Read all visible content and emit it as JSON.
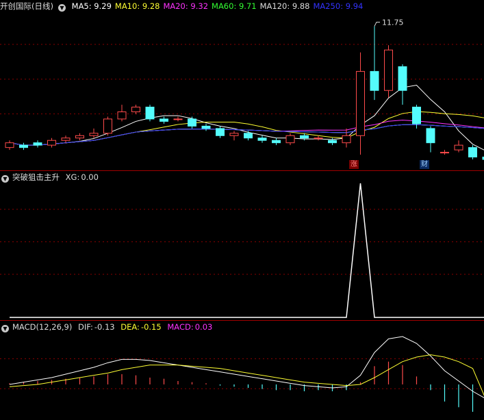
{
  "colors": {
    "up": "#ff4b4b",
    "down": "#54fcfc",
    "ma5": "#ffffff",
    "ma10": "#ffff33",
    "ma20": "#ff33ff",
    "ma60": "#33ff33",
    "ma120": "#dddddd",
    "ma250": "#3333ff",
    "grid": "#8b0000"
  },
  "main": {
    "stock_name": "开创国际",
    "period": "(日线)",
    "indicators": [
      {
        "label": "MA5:",
        "value": "9.29",
        "color": "#ffffff"
      },
      {
        "label": "MA10:",
        "value": "9.28",
        "color": "#ffff33"
      },
      {
        "label": "MA20:",
        "value": "9.32",
        "color": "#ff33ff"
      },
      {
        "label": "MA60:",
        "value": "9.71",
        "color": "#33ff33"
      },
      {
        "label": "MA120:",
        "value": "9.88",
        "color": "#dddddd"
      },
      {
        "label": "MA250:",
        "value": "9.94",
        "color": "#3333ff"
      }
    ],
    "high_marker": "11.75",
    "badge_limit_up": "涨",
    "badge_finance": "财"
  },
  "xg_panel": {
    "title": "突破狙击主升",
    "label": "XG:",
    "value": "0.00"
  },
  "macd_panel": {
    "title": "MACD(12,26,9)",
    "dif_label": "DIF:",
    "dif_value": "-0.13",
    "dea_label": "DEA:",
    "dea_value": "-0.15",
    "macd_label": "MACD:",
    "macd_value": "0.03"
  },
  "chart_data": {
    "type": "candlestick",
    "price_candles": [
      {
        "o": 9.2,
        "c": 9.3,
        "h": 9.35,
        "l": 9.15
      },
      {
        "o": 9.25,
        "c": 9.2,
        "h": 9.3,
        "l": 9.15
      },
      {
        "o": 9.3,
        "c": 9.25,
        "h": 9.35,
        "l": 9.2
      },
      {
        "o": 9.25,
        "c": 9.35,
        "h": 9.4,
        "l": 9.2
      },
      {
        "o": 9.35,
        "c": 9.4,
        "h": 9.45,
        "l": 9.3
      },
      {
        "o": 9.4,
        "c": 9.45,
        "h": 9.5,
        "l": 9.35
      },
      {
        "o": 9.45,
        "c": 9.5,
        "h": 9.6,
        "l": 9.4
      },
      {
        "o": 9.5,
        "c": 9.8,
        "h": 9.85,
        "l": 9.45
      },
      {
        "o": 9.8,
        "c": 9.95,
        "h": 10.1,
        "l": 9.75
      },
      {
        "o": 9.95,
        "c": 10.05,
        "h": 10.1,
        "l": 9.9
      },
      {
        "o": 10.05,
        "c": 9.8,
        "h": 10.1,
        "l": 9.75
      },
      {
        "o": 9.8,
        "c": 9.75,
        "h": 9.85,
        "l": 9.7
      },
      {
        "o": 9.8,
        "c": 9.8,
        "h": 9.85,
        "l": 9.75
      },
      {
        "o": 9.8,
        "c": 9.65,
        "h": 9.85,
        "l": 9.6
      },
      {
        "o": 9.65,
        "c": 9.6,
        "h": 9.7,
        "l": 9.55
      },
      {
        "o": 9.6,
        "c": 9.45,
        "h": 9.65,
        "l": 9.4
      },
      {
        "o": 9.45,
        "c": 9.5,
        "h": 9.55,
        "l": 9.35
      },
      {
        "o": 9.5,
        "c": 9.4,
        "h": 9.55,
        "l": 9.35
      },
      {
        "o": 9.4,
        "c": 9.35,
        "h": 9.45,
        "l": 9.3
      },
      {
        "o": 9.35,
        "c": 9.3,
        "h": 9.4,
        "l": 9.25
      },
      {
        "o": 9.3,
        "c": 9.45,
        "h": 9.5,
        "l": 9.25
      },
      {
        "o": 9.45,
        "c": 9.4,
        "h": 9.5,
        "l": 9.35
      },
      {
        "o": 9.4,
        "c": 9.4,
        "h": 9.45,
        "l": 9.35
      },
      {
        "o": 9.35,
        "c": 9.3,
        "h": 9.4,
        "l": 9.25
      },
      {
        "o": 9.3,
        "c": 9.45,
        "h": 9.6,
        "l": 9.2
      },
      {
        "o": 9.45,
        "c": 10.8,
        "h": 11.2,
        "l": 9.05
      },
      {
        "o": 10.8,
        "c": 10.4,
        "h": 11.75,
        "l": 10.2
      },
      {
        "o": 10.4,
        "c": 11.25,
        "h": 11.35,
        "l": 10.25
      },
      {
        "o": 10.9,
        "c": 10.4,
        "h": 10.95,
        "l": 10.1
      },
      {
        "o": 10.05,
        "c": 9.7,
        "h": 10.1,
        "l": 9.6
      },
      {
        "o": 9.6,
        "c": 9.3,
        "h": 9.65,
        "l": 9.1
      },
      {
        "o": 9.1,
        "c": 9.1,
        "h": 9.15,
        "l": 9.05
      },
      {
        "o": 9.15,
        "c": 9.25,
        "h": 9.35,
        "l": 9.1
      },
      {
        "o": 9.2,
        "c": 9.0,
        "h": 9.25,
        "l": 8.95
      },
      {
        "o": 9.0,
        "c": 8.95,
        "h": 9.05,
        "l": 8.9
      }
    ],
    "price_range": [
      8.85,
      12.1
    ],
    "xg_values": [
      0,
      0,
      0,
      0,
      0,
      0,
      0,
      0,
      0,
      0,
      0,
      0,
      0,
      0,
      0,
      0,
      0,
      0,
      0,
      0,
      0,
      0,
      0,
      0,
      0,
      1,
      0,
      0,
      0,
      0,
      0,
      0,
      0,
      0,
      0
    ],
    "macd_hist": [
      0.01,
      0.02,
      0.03,
      0.04,
      0.05,
      0.06,
      0.07,
      0.09,
      0.09,
      0.08,
      0.06,
      0.05,
      0.03,
      0.02,
      0.01,
      -0.01,
      -0.02,
      -0.03,
      -0.04,
      -0.05,
      -0.05,
      -0.06,
      -0.05,
      -0.06,
      -0.05,
      0.02,
      0.16,
      0.2,
      0.17,
      0.07,
      -0.05,
      -0.15,
      -0.2,
      -0.24,
      -0.28
    ],
    "dif": [
      0.0,
      0.02,
      0.04,
      0.06,
      0.09,
      0.12,
      0.15,
      0.19,
      0.22,
      0.22,
      0.21,
      0.19,
      0.17,
      0.15,
      0.13,
      0.11,
      0.09,
      0.07,
      0.05,
      0.03,
      0.01,
      -0.01,
      -0.02,
      -0.03,
      -0.02,
      0.08,
      0.28,
      0.4,
      0.42,
      0.36,
      0.25,
      0.12,
      0.03,
      -0.06,
      -0.13
    ],
    "dea": [
      -0.02,
      -0.01,
      0.0,
      0.02,
      0.04,
      0.06,
      0.08,
      0.1,
      0.13,
      0.15,
      0.17,
      0.17,
      0.17,
      0.16,
      0.15,
      0.14,
      0.12,
      0.1,
      0.08,
      0.06,
      0.04,
      0.02,
      0.01,
      0.0,
      -0.01,
      0.0,
      0.06,
      0.13,
      0.2,
      0.24,
      0.26,
      0.24,
      0.2,
      0.14,
      -0.15
    ],
    "macd_range": [
      -0.3,
      0.45
    ]
  }
}
